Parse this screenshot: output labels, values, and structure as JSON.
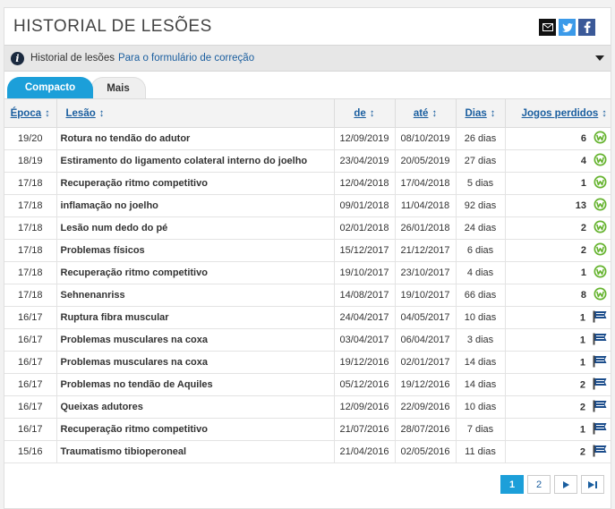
{
  "header": {
    "title": "HISTORIAL DE LESÕES"
  },
  "infobar": {
    "text": "Historial de lesões",
    "link": "Para o formulário de correção"
  },
  "tabs": [
    {
      "label": "Compacto",
      "active": true
    },
    {
      "label": "Mais",
      "active": false
    }
  ],
  "table": {
    "columns": [
      "Época",
      "Lesão",
      "de",
      "até",
      "Dias",
      "Jogos perdidos"
    ],
    "sort_glyph": "↕",
    "rows": [
      {
        "season": "19/20",
        "injury": "Rotura no tendão do adutor",
        "from": "12/09/2019",
        "until": "08/10/2019",
        "days": "26 dias",
        "games": "6",
        "club": "wolfsburg"
      },
      {
        "season": "18/19",
        "injury": "Estiramento do ligamento colateral interno do joelho",
        "from": "23/04/2019",
        "until": "20/05/2019",
        "days": "27 dias",
        "games": "4",
        "club": "wolfsburg"
      },
      {
        "season": "17/18",
        "injury": "Recuperação ritmo competitivo",
        "from": "12/04/2018",
        "until": "17/04/2018",
        "days": "5 dias",
        "games": "1",
        "club": "wolfsburg"
      },
      {
        "season": "17/18",
        "injury": "inflamação no joelho",
        "from": "09/01/2018",
        "until": "11/04/2018",
        "days": "92 dias",
        "games": "13",
        "club": "wolfsburg"
      },
      {
        "season": "17/18",
        "injury": "Lesão num dedo do pé",
        "from": "02/01/2018",
        "until": "26/01/2018",
        "days": "24 dias",
        "games": "2",
        "club": "wolfsburg"
      },
      {
        "season": "17/18",
        "injury": "Problemas físicos",
        "from": "15/12/2017",
        "until": "21/12/2017",
        "days": "6 dias",
        "games": "2",
        "club": "wolfsburg"
      },
      {
        "season": "17/18",
        "injury": "Recuperação ritmo competitivo",
        "from": "19/10/2017",
        "until": "23/10/2017",
        "days": "4 dias",
        "games": "1",
        "club": "wolfsburg"
      },
      {
        "season": "17/18",
        "injury": "Sehnenanriss",
        "from": "14/08/2017",
        "until": "19/10/2017",
        "days": "66 dias",
        "games": "8",
        "club": "wolfsburg"
      },
      {
        "season": "16/17",
        "injury": "Ruptura fibra muscular",
        "from": "24/04/2017",
        "until": "04/05/2017",
        "days": "10 dias",
        "games": "1",
        "club": "hertha"
      },
      {
        "season": "16/17",
        "injury": "Problemas musculares na coxa",
        "from": "03/04/2017",
        "until": "06/04/2017",
        "days": "3 dias",
        "games": "1",
        "club": "hertha"
      },
      {
        "season": "16/17",
        "injury": "Problemas musculares na coxa",
        "from": "19/12/2016",
        "until": "02/01/2017",
        "days": "14 dias",
        "games": "1",
        "club": "hertha"
      },
      {
        "season": "16/17",
        "injury": "Problemas no tendão de Aquiles",
        "from": "05/12/2016",
        "until": "19/12/2016",
        "days": "14 dias",
        "games": "2",
        "club": "hertha"
      },
      {
        "season": "16/17",
        "injury": "Queixas adutores",
        "from": "12/09/2016",
        "until": "22/09/2016",
        "days": "10 dias",
        "games": "2",
        "club": "hertha"
      },
      {
        "season": "16/17",
        "injury": "Recuperação ritmo competitivo",
        "from": "21/07/2016",
        "until": "28/07/2016",
        "days": "7 dias",
        "games": "1",
        "club": "hertha"
      },
      {
        "season": "15/16",
        "injury": "Traumatismo tibioperoneal",
        "from": "21/04/2016",
        "until": "02/05/2016",
        "days": "11 dias",
        "games": "2",
        "club": "hertha"
      }
    ]
  },
  "pager": {
    "pages": [
      "1",
      "2"
    ],
    "current": "1",
    "next": "▶",
    "last": "▶|"
  },
  "colors": {
    "accent": "#1c9fd9",
    "link": "#1a5e9f",
    "wolfsburg": "#65b32e",
    "hertha": "#1a4c8b"
  },
  "icons": {
    "mail": "mail-icon",
    "twitter": "twitter-icon",
    "facebook": "facebook-icon",
    "info": "info-icon"
  }
}
